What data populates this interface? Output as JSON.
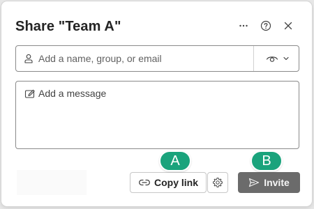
{
  "dialog": {
    "title": "Share \"Team A\"",
    "more_icon": "more-options-icon",
    "help_icon": "help-icon",
    "close_icon": "close-icon"
  },
  "people_field": {
    "placeholder": "Add a name, group, or email",
    "value": "",
    "icon": "person-icon",
    "permission_icon": "eye-icon",
    "dropdown_icon": "chevron-down-icon"
  },
  "message_field": {
    "placeholder": "Add a message",
    "value": "",
    "icon": "pencil-icon"
  },
  "footer": {
    "copy_link_label": "Copy link",
    "copy_link_icon": "link-icon",
    "settings_icon": "gear-icon",
    "invite_label": "Invite",
    "invite_icon": "send-icon"
  },
  "markers": {
    "a": "A",
    "b": "B"
  },
  "colors": {
    "marker": "#1aa37c",
    "invite_button": "#6b6b6b",
    "field_border": "#8a8a8a"
  }
}
